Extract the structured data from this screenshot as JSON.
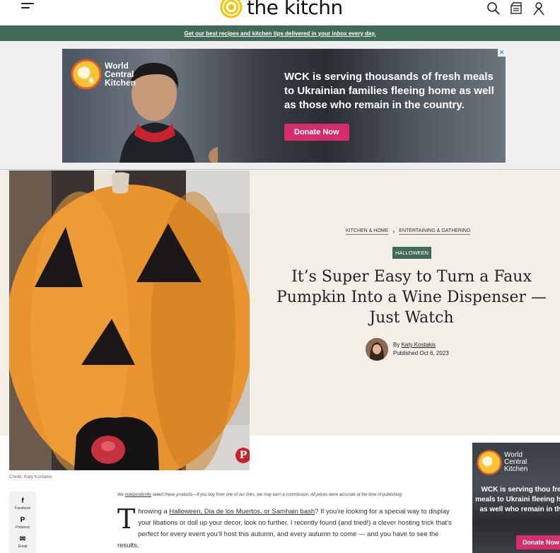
{
  "header": {
    "logo_text": "the kitchn",
    "icons": [
      "menu-icon",
      "search-icon",
      "recipe-box-icon",
      "account-icon"
    ]
  },
  "promo": {
    "text": "Get our best recipes and kitchen tips delivered in your inbox every day."
  },
  "top_ad": {
    "brand": "World\nCentral\nKitchen",
    "headline": "WCK is serving thousands of fresh meals to Ukrainian families fleeing home as well as those who remain in the country.",
    "cta": "Donate Now",
    "close": "✕"
  },
  "article": {
    "breadcrumb": [
      "KITCHEN & HOME",
      "ENTERTAINING & GATHERING"
    ],
    "tag": "HALLOWEEN",
    "title": "It’s Super Easy to Turn a Faux Pumpkin Into a Wine Dispenser — Just Watch",
    "byline_prefix": "By",
    "author": "Katy Kostakis",
    "published": "Published Oct 6, 2023",
    "image_credit": "Credit: Katy Kostakis",
    "pin_label": "P",
    "disclaimer_pre": "We",
    "disclaimer_link": "independently",
    "disclaimer_post": "select these products—if you buy from one of our links, we may earn a commission. All prices were accurate at the time of publishing.",
    "drop_cap": "T",
    "body_pre": "hrowing a",
    "body_link": "Halloween, Dia de los Muertos, or Samhain bash",
    "body_post": "? If you’re looking for a special way to display your libations or doll up your decor, look no further. I recently found (and tried!) a clever hosting trick that’s perfect for every event you’ll host this autumn, and every autumn to come — and you have to see the results."
  },
  "share": [
    {
      "icon": "f",
      "label": "Facebook"
    },
    {
      "icon": "P",
      "label": "Pinterest"
    },
    {
      "icon": "✉",
      "label": "Email"
    }
  ],
  "side_ad": {
    "brand": "World\nCentral\nKitchen",
    "headline": "WCK is serving thou fresh meals to Ukraini fleeing home as well who remain in the c",
    "cta": "Donate Now"
  },
  "colors": {
    "brand_green": "#3f6b57",
    "donate_pink": "#d42f6b",
    "logo_yellow": "#f5c400",
    "pumpkin_orange": "#e8932d",
    "hero_bg": "#f3efe7"
  }
}
